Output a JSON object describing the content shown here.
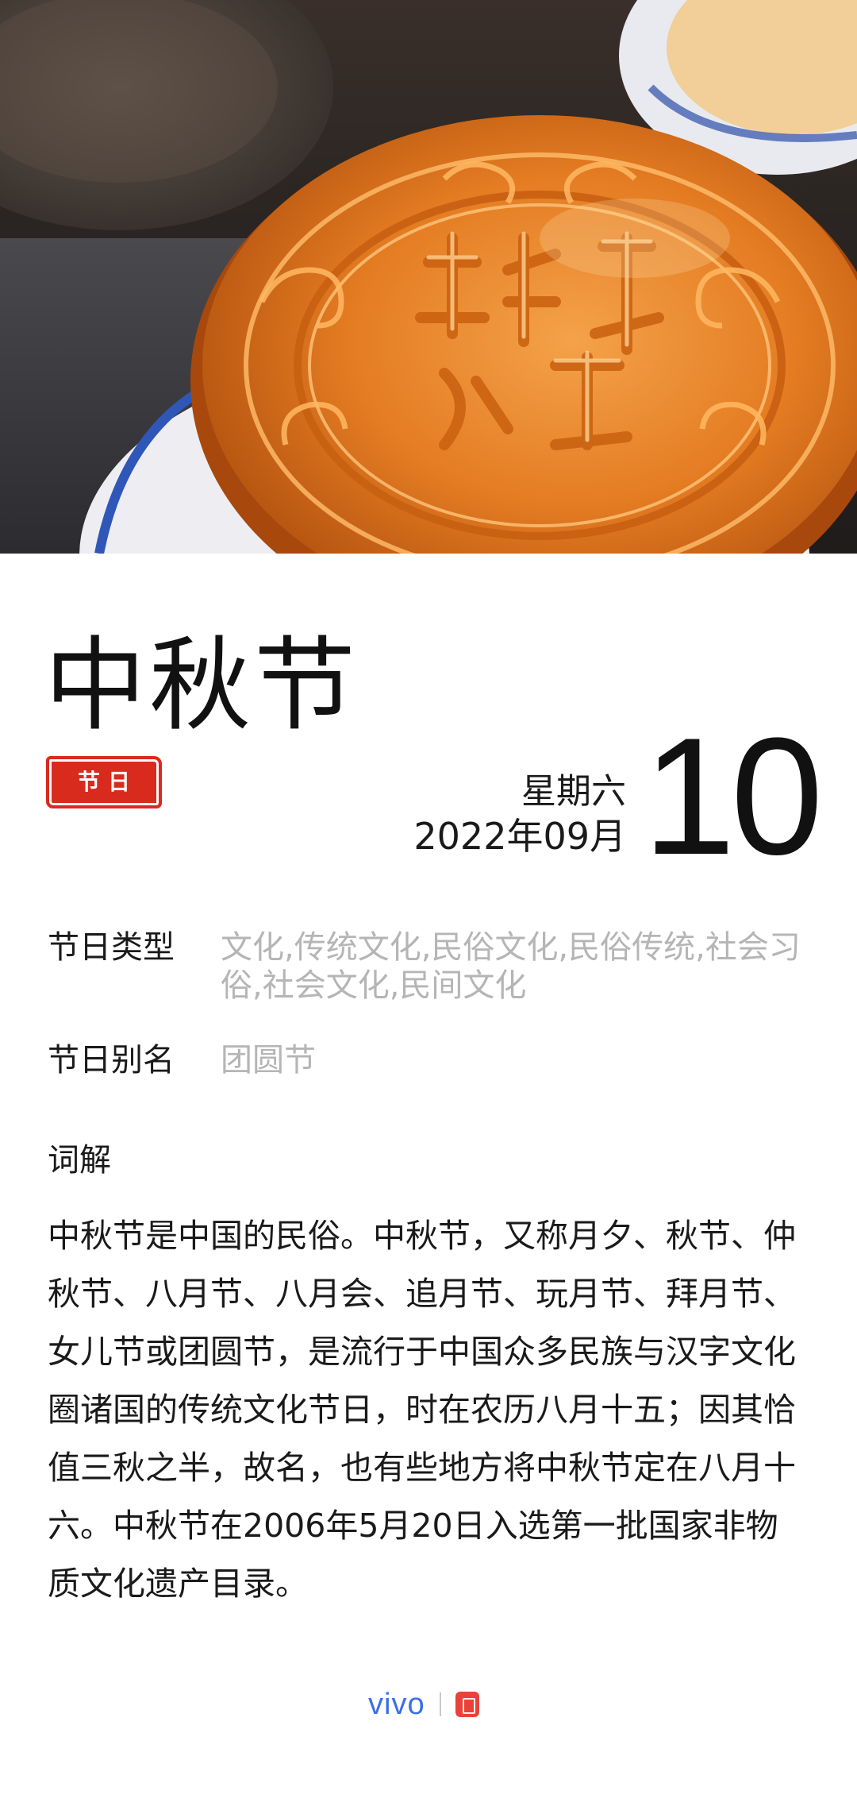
{
  "festival": {
    "title": "中秋节",
    "tag": "节日"
  },
  "date": {
    "weekday": "星期六",
    "year_month": "2022年09月",
    "day": "10"
  },
  "attributes": [
    {
      "label": "节日类型",
      "value": "文化,传统文化,民俗文化,民俗传统,社会习俗,社会文化,民间文化"
    },
    {
      "label": "节日别名",
      "value": "团圆节"
    }
  ],
  "definition": {
    "heading": "词解",
    "text": "中秋节是中国的民俗。中秋节，又称月夕、秋节、仲秋节、八月节、八月会、追月节、玩月节、拜月节、女儿节或团圆节，是流行于中国众多民族与汉字文化圈诸国的传统文化节日，时在农历八月十五；因其恰值三秋之半，故名，也有些地方将中秋节定在八月十六。中秋节在2006年5月20日入选第一批国家非物质文化遗产目录。"
  },
  "footer": {
    "brand": "vivo",
    "app_icon": "calendar-app-icon"
  },
  "colors": {
    "stamp_red": "#d92b1d",
    "muted_text": "#b5b5b5",
    "brand_blue": "#3b6fe8",
    "mooncake_orange": "#e0741e"
  },
  "hero_image": {
    "subject": "mooncake-photo"
  }
}
